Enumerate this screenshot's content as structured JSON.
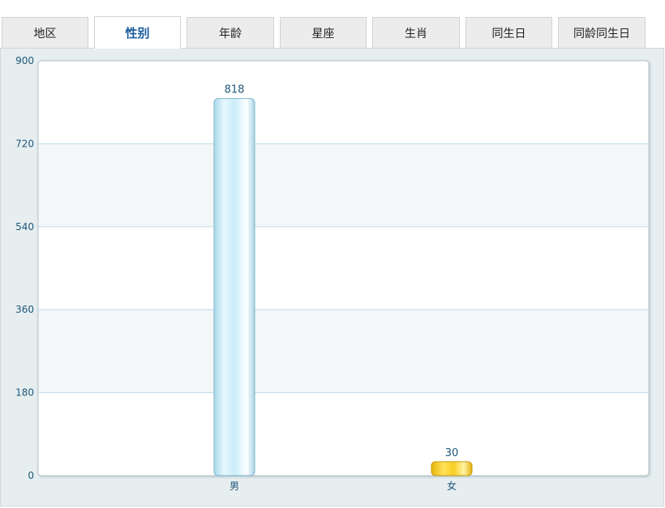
{
  "tabs": [
    {
      "label": "地区",
      "active": false
    },
    {
      "label": "性别",
      "active": true
    },
    {
      "label": "年龄",
      "active": false
    },
    {
      "label": "星座",
      "active": false
    },
    {
      "label": "生肖",
      "active": false
    },
    {
      "label": "同生日",
      "active": false
    },
    {
      "label": "同龄同生日",
      "active": false
    }
  ],
  "colors": {
    "male_bar": "#d6f2fb",
    "female_bar": "#f9cf23",
    "grid_line": "#bfdde8",
    "band_fill": "#f3f7f8",
    "axis_text": "#1f5878"
  },
  "chart_data": {
    "type": "bar",
    "categories": [
      "男",
      "女"
    ],
    "values": [
      818,
      30
    ],
    "ylim": [
      0,
      900
    ],
    "yticks": [
      0,
      180,
      360,
      540,
      720,
      900
    ],
    "title": "",
    "xlabel": "",
    "ylabel": "",
    "grid": true,
    "legend": "none"
  }
}
